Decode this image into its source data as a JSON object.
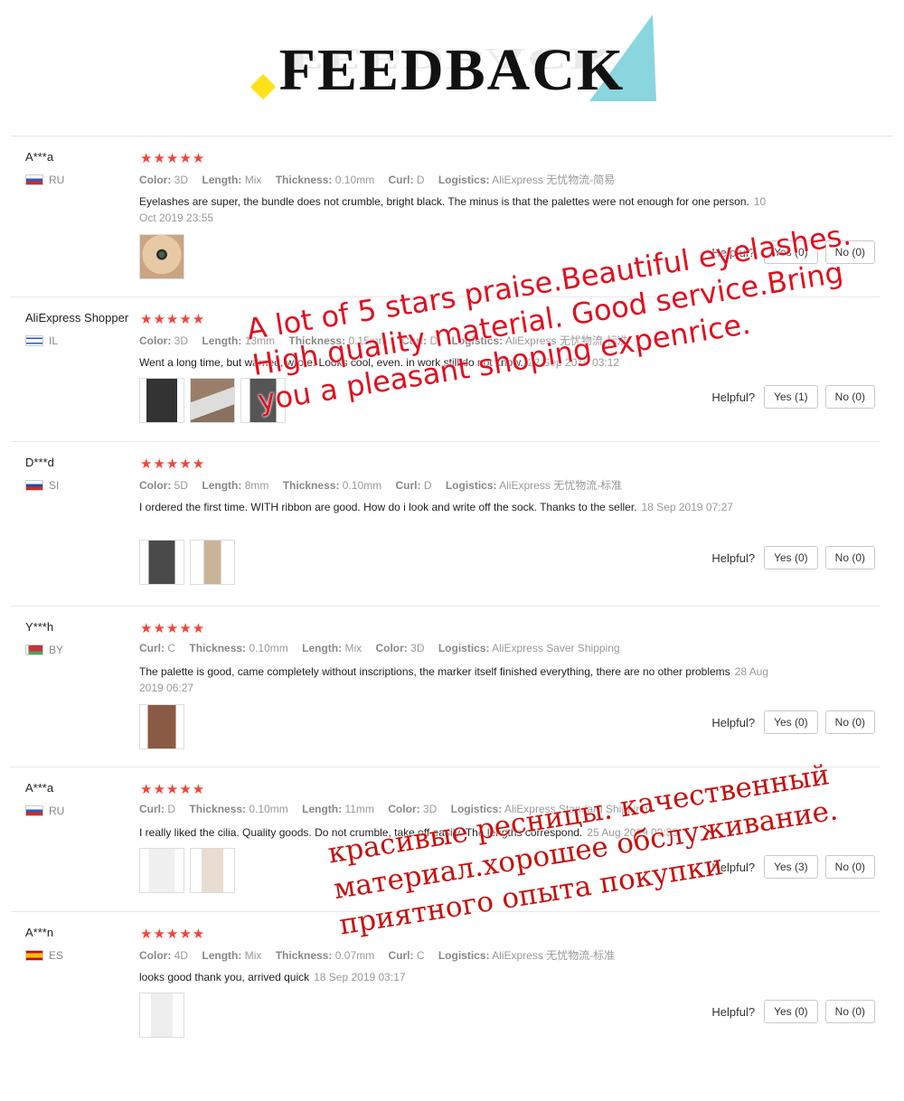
{
  "header": {
    "title": "FEEDBACK",
    "colors": {
      "triangle": "#89d6df",
      "diamond": "#ffe11a"
    }
  },
  "helpful_label": "Helpful?",
  "stars": "★★★★★",
  "reviews": [
    {
      "user": "A***a",
      "country": "RU",
      "attrs": [
        {
          "k": "Color:",
          "v": "3D"
        },
        {
          "k": "Length:",
          "v": "Mix"
        },
        {
          "k": "Thickness:",
          "v": "0.10mm"
        },
        {
          "k": "Curl:",
          "v": "D"
        },
        {
          "k": "Logistics:",
          "v": "AliExpress 无忧物流-简易"
        }
      ],
      "text": "Eyelashes are super, the bundle does not crumble, bright black. The minus is that the palettes were not enough for one person.",
      "date": "10 Oct 2019 23:55",
      "yes": "Yes (0)",
      "no": "No (0)"
    },
    {
      "user": "AliExpress Shopper",
      "country": "IL",
      "attrs": [
        {
          "k": "Color:",
          "v": "3D"
        },
        {
          "k": "Length:",
          "v": "13mm"
        },
        {
          "k": "Thickness:",
          "v": "0.15mm"
        },
        {
          "k": "Curl:",
          "v": "D"
        },
        {
          "k": "Logistics:",
          "v": "AliExpress 无忧物流-标准"
        }
      ],
      "text": "Went a long time, but warned, wrote. Looks cool, even. in work still do not know.",
      "date": "22 Sep 2019 03:12",
      "yes": "Yes (1)",
      "no": "No (0)"
    },
    {
      "user": "D***d",
      "country": "SI",
      "attrs": [
        {
          "k": "Color:",
          "v": "5D"
        },
        {
          "k": "Length:",
          "v": "8mm"
        },
        {
          "k": "Thickness:",
          "v": "0.10mm"
        },
        {
          "k": "Curl:",
          "v": "D"
        },
        {
          "k": "Logistics:",
          "v": "AliExpress 无忧物流-标准"
        }
      ],
      "text": "I ordered the first time. WITH ribbon are good. How do i look and write off the sock. Thanks to the seller.",
      "date": "18 Sep 2019 07:27",
      "yes": "Yes (0)",
      "no": "No (0)"
    },
    {
      "user": "Y***h",
      "country": "BY",
      "attrs": [
        {
          "k": "Curl:",
          "v": "C"
        },
        {
          "k": "Thickness:",
          "v": "0.10mm"
        },
        {
          "k": "Length:",
          "v": "Mix"
        },
        {
          "k": "Color:",
          "v": "3D"
        },
        {
          "k": "Logistics:",
          "v": "AliExpress Saver Shipping"
        }
      ],
      "text": "The palette is good, came completely without inscriptions, the marker itself finished everything, there are no other problems",
      "date": "28 Aug 2019 06:27",
      "yes": "Yes (0)",
      "no": "No (0)"
    },
    {
      "user": "A***a",
      "country": "RU",
      "attrs": [
        {
          "k": "Curl:",
          "v": "D"
        },
        {
          "k": "Thickness:",
          "v": "0.10mm"
        },
        {
          "k": "Length:",
          "v": "11mm"
        },
        {
          "k": "Color:",
          "v": "3D"
        },
        {
          "k": "Logistics:",
          "v": "AliExpress Standard Shipping"
        }
      ],
      "text": "I really liked the cilia. Quality goods. Do not crumble, take off easily. The lengths correspond.",
      "date": "25 Aug 2019 09:33",
      "yes": "Yes (3)",
      "no": "No (0)"
    },
    {
      "user": "A***n",
      "country": "ES",
      "attrs": [
        {
          "k": "Color:",
          "v": "4D"
        },
        {
          "k": "Length:",
          "v": "Mix"
        },
        {
          "k": "Thickness:",
          "v": "0.07mm"
        },
        {
          "k": "Curl:",
          "v": "C"
        },
        {
          "k": "Logistics:",
          "v": "AliExpress 无忧物流-标准"
        }
      ],
      "text": "looks good thank you, arrived quick",
      "date": "18 Sep 2019 03:17",
      "yes": "Yes (0)",
      "no": "No (0)"
    }
  ],
  "overlay_en": "A lot of 5 stars praise.Beautiful eyelashes. High quality material. Good service.Bring you a pleasant shoping expenrice.",
  "overlay_ru": "красивые ресницы. качественный материал.хорошее обслуживание. приятного опыта покупки"
}
